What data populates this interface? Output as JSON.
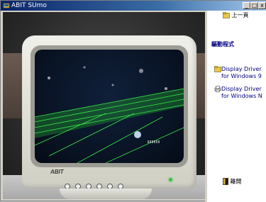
{
  "window": {
    "title": "ABIT SUmo",
    "buttons": {
      "minimize": "_",
      "maximize": "□",
      "close": "x"
    }
  },
  "sidebar": {
    "back_label": "上一頁",
    "section_title": "驅動程式",
    "items": [
      {
        "line1": "Display Driver",
        "line2": "for Windows 9",
        "icon": "folder-icon"
      },
      {
        "line1": "Display Driver",
        "line2": "for Windows N",
        "icon": "printer-icon"
      }
    ],
    "exit_label": "離開"
  },
  "monitor": {
    "brand_text": "ABIT"
  },
  "colors": {
    "title_start": "#0a246a",
    "link": "#000080",
    "screen_green": "#3cff4a"
  }
}
